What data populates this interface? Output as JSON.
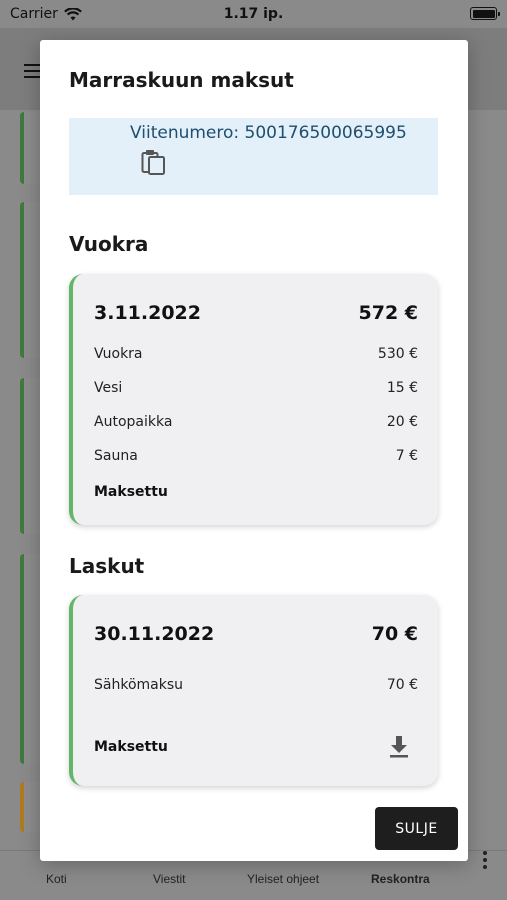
{
  "status_bar": {
    "carrier": "Carrier",
    "time": "1.17 ip."
  },
  "dialog": {
    "title": "Marraskuun maksut",
    "reference": "Viitenumero: 500176500065995",
    "rent_section": {
      "title": "Vuokra",
      "date": "3.11.2022",
      "total": "572 €",
      "items": [
        {
          "label": "Vuokra",
          "amount": "530 €"
        },
        {
          "label": "Vesi",
          "amount": "15 €"
        },
        {
          "label": "Autopaikka",
          "amount": "20 €"
        },
        {
          "label": "Sauna",
          "amount": "7 €"
        }
      ],
      "status": "Maksettu"
    },
    "invoice_section": {
      "title": "Laskut",
      "date": "30.11.2022",
      "total": "70  €",
      "items": [
        {
          "label": "Sähkömaksu",
          "amount": "70  €"
        }
      ],
      "status": "Maksettu"
    },
    "close_label": "SULJE"
  },
  "tabbar": {
    "tabs": [
      {
        "label": "Koti"
      },
      {
        "label": "Viestit"
      },
      {
        "label": "Yleiset ohjeet"
      },
      {
        "label": "Reskontra"
      }
    ]
  },
  "colors": {
    "paid_accent": "#62b667",
    "reference_bg": "#e3eff9",
    "overlay": "#8a8a8a"
  }
}
